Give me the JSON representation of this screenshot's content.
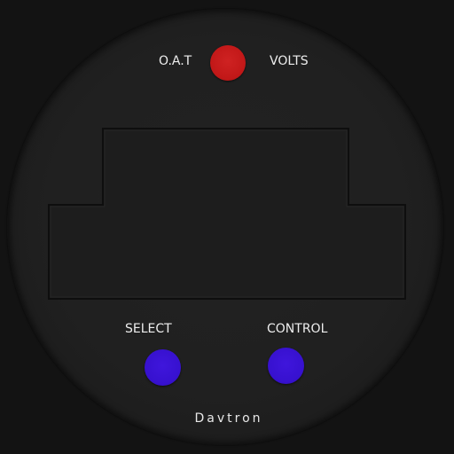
{
  "instrument": {
    "top_left_label": "O.A.T",
    "top_right_label": "VOLTS",
    "bottom_left_label": "SELECT",
    "bottom_right_label": "CONTROL",
    "brand": "Davtron"
  },
  "colors": {
    "mode_button": "#c91b1b",
    "select_button": "#3711cf",
    "control_button": "#3711cf",
    "bezel": "#202020",
    "background": "#131313"
  },
  "icons": {
    "mode_button": "red-round-button",
    "select_button": "blue-round-button",
    "control_button": "blue-round-button"
  }
}
